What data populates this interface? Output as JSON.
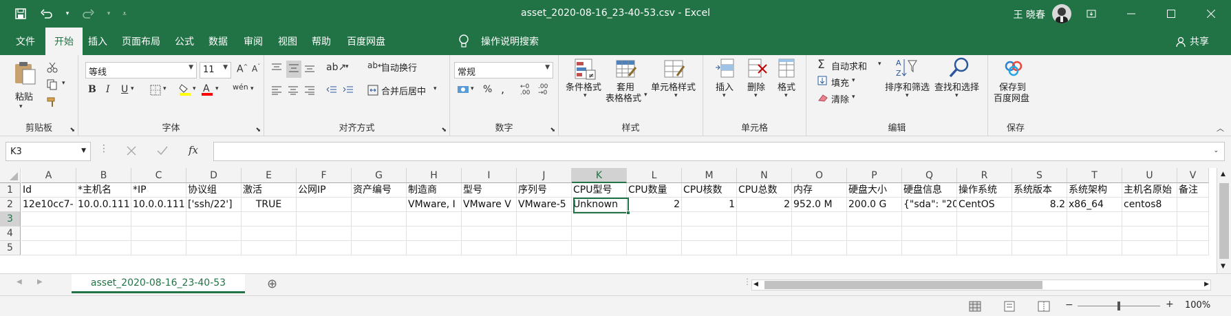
{
  "window": {
    "title": "asset_2020-08-16_23-40-53.csv  -  Excel",
    "user": "王 晓春",
    "share": "共享"
  },
  "ribbon_tabs": [
    {
      "label": "文件"
    },
    {
      "label": "开始"
    },
    {
      "label": "插入"
    },
    {
      "label": "页面布局"
    },
    {
      "label": "公式"
    },
    {
      "label": "数据"
    },
    {
      "label": "审阅"
    },
    {
      "label": "视图"
    },
    {
      "label": "帮助"
    },
    {
      "label": "百度网盘"
    }
  ],
  "tell_me": "操作说明搜索",
  "clipboard": {
    "paste": "粘贴",
    "group": "剪贴板"
  },
  "font": {
    "name": "等线",
    "size": "11",
    "group": "字体"
  },
  "alignment": {
    "wrap": "自动换行",
    "merge": "合并后居中",
    "group": "对齐方式"
  },
  "number": {
    "format": "常规",
    "group": "数字"
  },
  "styles": {
    "conditional": "条件格式",
    "table_line1": "套用",
    "table_line2": "表格格式",
    "cell_styles": "单元格样式",
    "group": "样式"
  },
  "cells": {
    "insert": "插入",
    "delete": "删除",
    "format": "格式",
    "group": "单元格"
  },
  "editing": {
    "autosum": "自动求和",
    "fill": "填充",
    "clear": "清除",
    "sort": "排序和筛选",
    "find": "查找和选择",
    "group": "编辑"
  },
  "save": {
    "line1": "保存到",
    "line2": "百度网盘",
    "group": "保存"
  },
  "formula_bar": {
    "name_box": "K3",
    "fx": "fx",
    "value": ""
  },
  "columns": [
    "A",
    "B",
    "C",
    "D",
    "E",
    "F",
    "G",
    "H",
    "I",
    "J",
    "K",
    "L",
    "M",
    "N",
    "O",
    "P",
    "Q",
    "R",
    "S",
    "T",
    "U",
    "V"
  ],
  "rows": [
    "1",
    "2",
    "3",
    "4",
    "5"
  ],
  "header_row": [
    "Id",
    "*主机名",
    "*IP",
    "协议组",
    "激活",
    "公网IP",
    "资产编号",
    "制造商",
    "型号",
    "序列号",
    "CPU型号",
    "CPU数量",
    "CPU核数",
    "CPU总数",
    "内存",
    "硬盘大小",
    "硬盘信息",
    "操作系统",
    "系统版本",
    "系统架构",
    "主机名原始",
    "备注"
  ],
  "data_row": [
    "12e10cc7-",
    "10.0.0.111",
    "10.0.0.111",
    "['ssh/22']",
    "TRUE",
    "",
    "",
    "VMware, I",
    "VMware V",
    "VMware-5",
    "Unknown",
    "2",
    "1",
    "2",
    "952.0 M",
    "200.0 G",
    "{\"sda\": \"20",
    "CentOS",
    "8.2",
    "x86_64",
    "centos8",
    ""
  ],
  "sheet_tab": "asset_2020-08-16_23-40-53",
  "zoom": "100%",
  "colors": {
    "accent": "#217346"
  }
}
